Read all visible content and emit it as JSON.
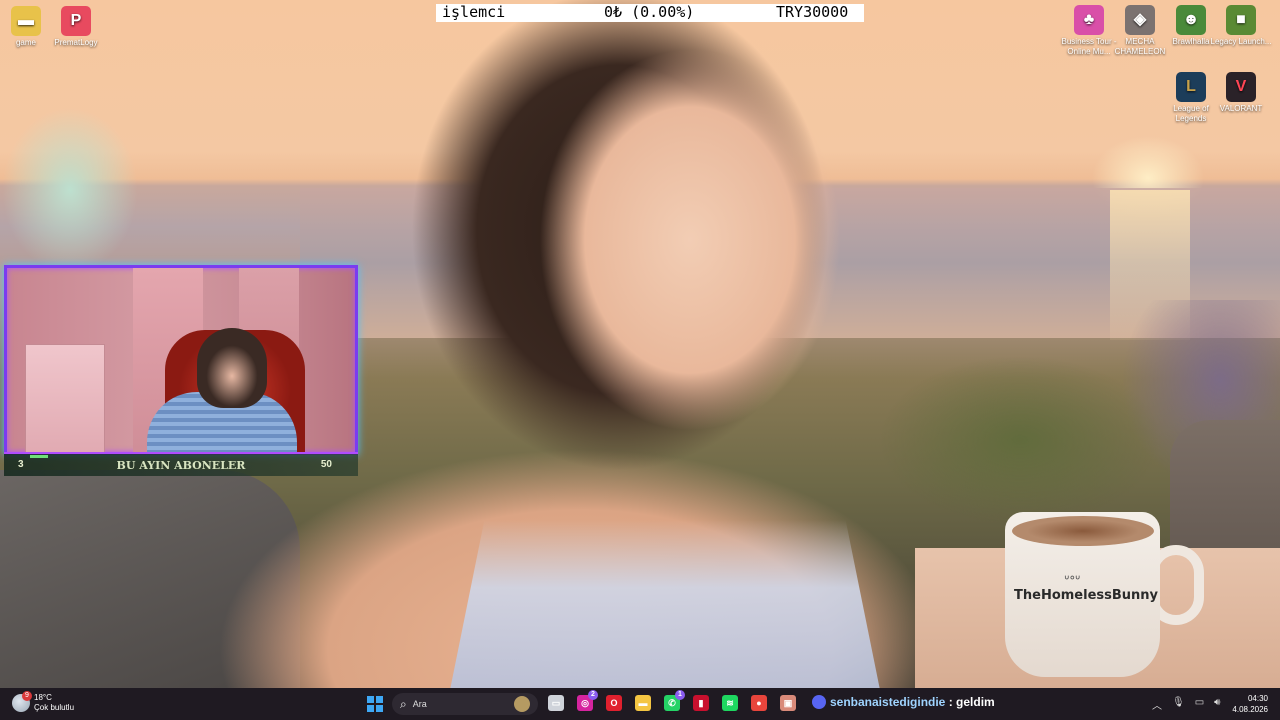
{
  "ticker": {
    "symbol": "işlemci",
    "value": "0₺ (0.00%)",
    "target": "TRY30000"
  },
  "desktop_icons_left": [
    {
      "label": "game",
      "icon": "folder-icon",
      "color": "#e8c24a"
    },
    {
      "label": "PrematLogy",
      "icon": "prematlogy-icon",
      "color": "#e84a5f"
    }
  ],
  "desktop_icons_right": [
    {
      "label": "Business Tour - Online Mu...",
      "icon": "business-tour-icon",
      "color": "#d94fa8"
    },
    {
      "label": "MECHA CHAMELEON",
      "icon": "mecha-chameleon-icon",
      "color": "#7b7270"
    },
    {
      "label": "Brawlhalla",
      "icon": "brawlhalla-icon",
      "color": "#4a8a3a"
    },
    {
      "label": "Legacy Launch...",
      "icon": "minecraft-legacy-icon",
      "color": "#5a8a34"
    },
    {
      "label": "League of Legends",
      "icon": "league-of-legends-icon",
      "color": "#1c3d5a"
    },
    {
      "label": "VALORANT",
      "icon": "valorant-icon",
      "color": "#2a2228"
    }
  ],
  "mug_text": "TheHomelessBunny",
  "sub_goal": {
    "title": "BU AYIN ABONELER",
    "current": "3",
    "goal": "50",
    "progress": 0.06
  },
  "taskbar": {
    "weather": {
      "temp": "18°C",
      "condition": "Çok bulutlu",
      "badge": "9"
    },
    "search_placeholder": "Ara",
    "apps": [
      {
        "name": "file-explorer",
        "glyph": "▭",
        "color": "#cfd3da",
        "badge": ""
      },
      {
        "name": "instagram",
        "glyph": "◎",
        "color": "#d6249f",
        "badge": "2"
      },
      {
        "name": "opera",
        "glyph": "O",
        "color": "#e0202e",
        "badge": ""
      },
      {
        "name": "folder",
        "glyph": "▬",
        "color": "#f4c542",
        "badge": ""
      },
      {
        "name": "whatsapp",
        "glyph": "✆",
        "color": "#25d366",
        "badge": "1"
      },
      {
        "name": "unknown-red",
        "glyph": "▮",
        "color": "#c8102e",
        "badge": ""
      },
      {
        "name": "spotify",
        "glyph": "≋",
        "color": "#1ed760",
        "badge": ""
      },
      {
        "name": "chrome",
        "glyph": "●",
        "color": "#e8453c",
        "badge": ""
      },
      {
        "name": "photos",
        "glyph": "▣",
        "color": "#d98a7a",
        "badge": ""
      }
    ],
    "now_playing": {
      "song": "senbanaistedigindie",
      "sep": " : ",
      "status": "geldim"
    },
    "clock": {
      "time": "04:30",
      "date": "4.08.2026"
    }
  }
}
